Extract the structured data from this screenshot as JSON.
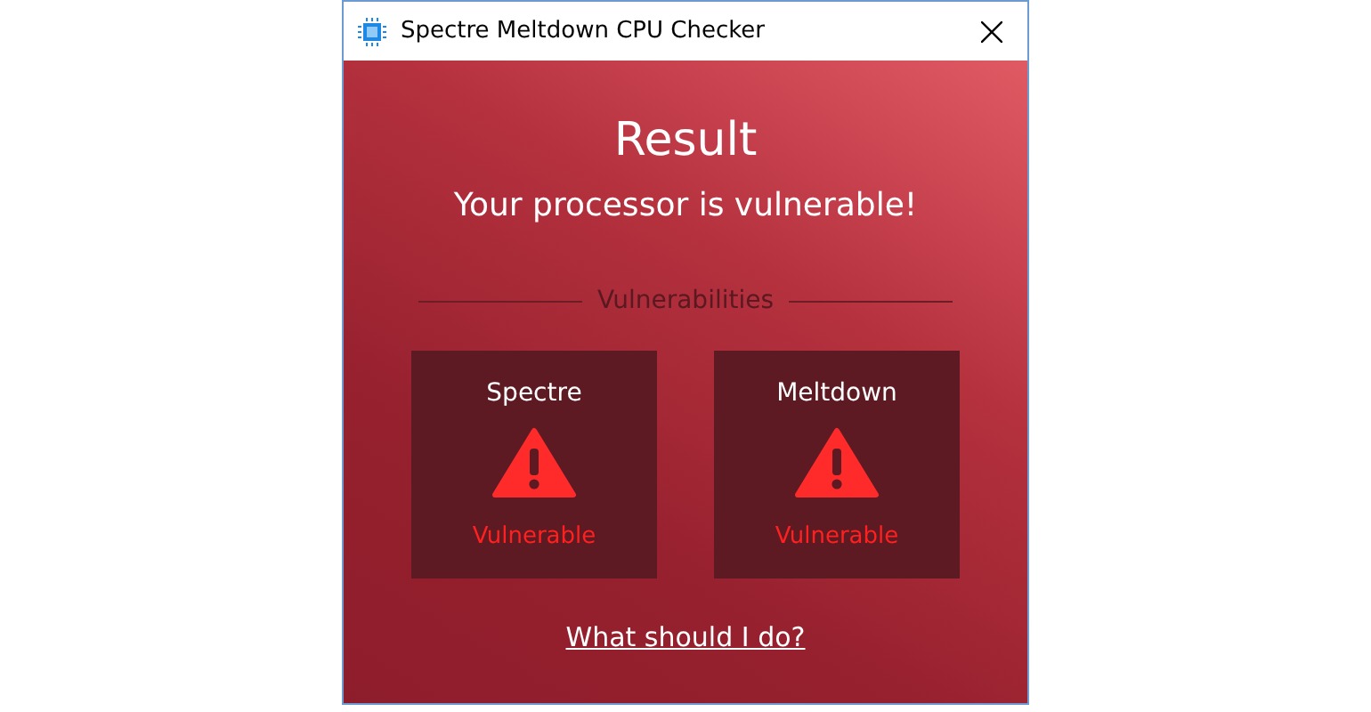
{
  "window": {
    "title": "Spectre Meltdown CPU Checker"
  },
  "heading": "Result",
  "subheading": "Your processor is vulnerable!",
  "section_title": "Vulnerabilities",
  "vulnerabilities": [
    {
      "name": "Spectre",
      "vulnerable": true,
      "status": "Vulnerable"
    },
    {
      "name": "Meltdown",
      "vulnerable": true,
      "status": "Vulnerable"
    }
  ],
  "help_link": "What should I do?"
}
